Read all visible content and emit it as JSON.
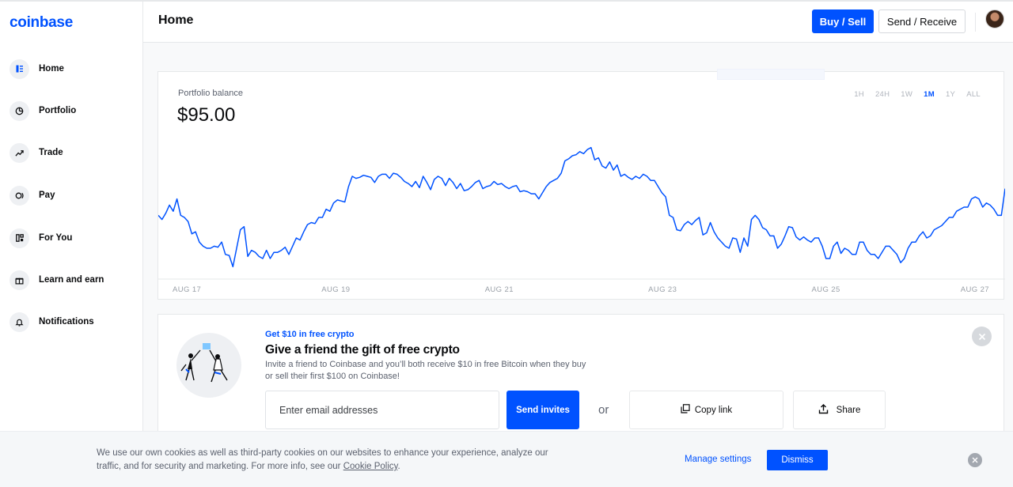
{
  "app": {
    "logo": "coinbase"
  },
  "sidebar": {
    "items": [
      {
        "label": "Home",
        "icon": "home-icon"
      },
      {
        "label": "Portfolio",
        "icon": "pie-chart-icon"
      },
      {
        "label": "Trade",
        "icon": "trend-icon"
      },
      {
        "label": "Pay",
        "icon": "pay-icon"
      },
      {
        "label": "For You",
        "icon": "grid-icon"
      },
      {
        "label": "Learn and earn",
        "icon": "gift-icon"
      },
      {
        "label": "Notifications",
        "icon": "bell-icon"
      }
    ]
  },
  "header": {
    "title": "Home",
    "buy_sell_label": "Buy / Sell",
    "send_receive_label": "Send / Receive"
  },
  "portfolio": {
    "balance_label": "Portfolio balance",
    "balance_value": "$95.00",
    "ranges": [
      "1H",
      "24H",
      "1W",
      "1M",
      "1Y",
      "ALL"
    ],
    "active_range": "1M"
  },
  "chart_data": {
    "type": "line",
    "x_ticks": [
      "AUG 17",
      "AUG 19",
      "AUG 21",
      "AUG 23",
      "AUG 25",
      "AUG 27"
    ],
    "values": [
      62,
      58,
      64,
      72,
      66,
      78,
      62,
      60,
      56,
      44,
      46,
      36,
      32,
      30,
      30,
      32,
      31,
      36,
      24,
      23,
      12,
      30,
      48,
      51,
      22,
      28,
      26,
      22,
      20,
      28,
      20,
      26,
      26,
      28,
      31,
      24,
      32,
      40,
      38,
      46,
      53,
      55,
      54,
      60,
      60,
      68,
      66,
      74,
      77,
      76,
      75,
      90,
      100,
      98,
      99,
      101,
      100,
      99,
      94,
      100,
      102,
      102,
      98,
      103,
      102,
      99,
      95,
      93,
      90,
      95,
      89,
      100,
      94,
      87,
      97,
      100,
      98,
      91,
      98,
      94,
      88,
      93,
      86,
      87,
      90,
      94,
      96,
      88,
      90,
      91,
      95,
      92,
      93,
      90,
      88,
      90,
      91,
      85,
      86,
      85,
      83,
      83,
      78,
      84,
      90,
      94,
      96,
      98,
      103,
      115,
      117,
      120,
      121,
      124,
      122,
      126,
      128,
      116,
      118,
      110,
      108,
      114,
      106,
      111,
      100,
      102,
      99,
      97,
      100,
      98,
      102,
      100,
      96,
      96,
      90,
      84,
      80,
      62,
      60,
      48,
      47,
      53,
      56,
      53,
      57,
      60,
      43,
      45,
      55,
      46,
      40,
      36,
      32,
      30,
      40,
      39,
      26,
      40,
      32,
      58,
      62,
      58,
      50,
      48,
      42,
      42,
      30,
      34,
      42,
      51,
      50,
      41,
      38,
      41,
      38,
      36,
      40,
      40,
      32,
      20,
      20,
      32,
      36,
      25,
      30,
      28,
      24,
      24,
      36,
      36,
      28,
      24,
      24,
      20,
      26,
      32,
      32,
      28,
      24,
      16,
      20,
      30,
      36,
      36,
      42,
      46,
      40,
      42,
      48,
      50,
      52,
      56,
      60,
      60,
      66,
      68,
      70,
      70,
      78,
      80,
      78,
      70,
      74,
      72,
      68,
      62,
      62,
      88
    ],
    "ylim": [
      0,
      140
    ]
  },
  "referral": {
    "kicker": "Get $10 in free crypto",
    "title": "Give a friend the gift of free crypto",
    "description": "Invite a friend to Coinbase and you’ll both receive $10 in free Bitcoin when they buy or sell their first $100 on Coinbase!",
    "email_placeholder": "Enter email addresses",
    "send_invites_label": "Send invites",
    "or_label": "or",
    "copy_link_label": "Copy link",
    "share_label": "Share"
  },
  "cookie": {
    "text": "We use our own cookies as well as third-party cookies on our websites to enhance your experience, analyze our traffic, and for security and marketing. For more info, see our",
    "link_label": "Cookie Policy",
    "after_link": ".",
    "manage_label": "Manage settings",
    "dismiss_label": "Dismiss"
  },
  "colors": {
    "brand": "#0052ff",
    "text_secondary": "#5b616e",
    "chart_line": "#0052ff"
  }
}
